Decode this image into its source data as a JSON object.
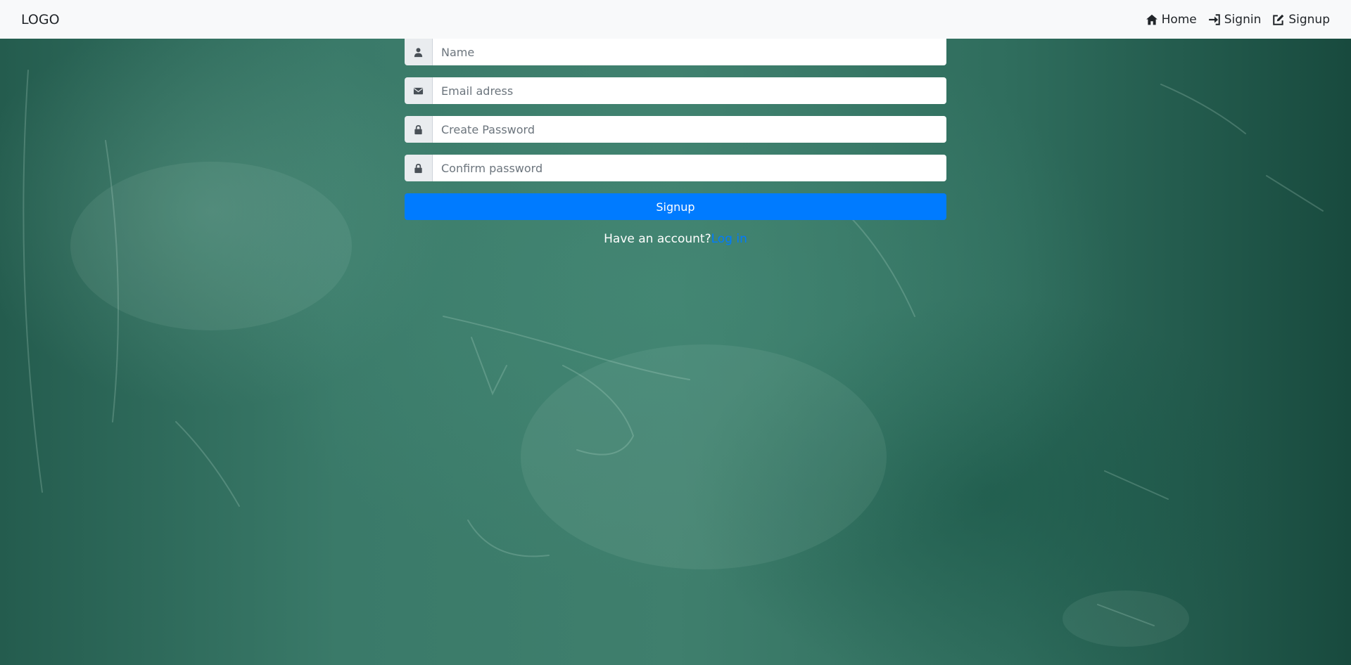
{
  "navbar": {
    "brand": "LOGO",
    "links": [
      {
        "label": "Home",
        "icon": "home-icon"
      },
      {
        "label": "Signin",
        "icon": "sign-in-icon"
      },
      {
        "label": "Signup",
        "icon": "edit-icon"
      }
    ]
  },
  "form": {
    "fields": [
      {
        "placeholder": "Name",
        "value": "",
        "icon": "user-icon"
      },
      {
        "placeholder": "Email adress",
        "value": "",
        "icon": "envelope-icon"
      },
      {
        "placeholder": "Create Password",
        "value": "",
        "icon": "lock-icon"
      },
      {
        "placeholder": "Confirm password",
        "value": "",
        "icon": "lock-icon"
      }
    ],
    "submit_label": "Signup",
    "account_prompt": "Have an account?",
    "login_link": "Log in"
  },
  "colors": {
    "navbar_bg": "#f8f9fa",
    "primary": "#007bff",
    "board": "#2f6b5c"
  }
}
